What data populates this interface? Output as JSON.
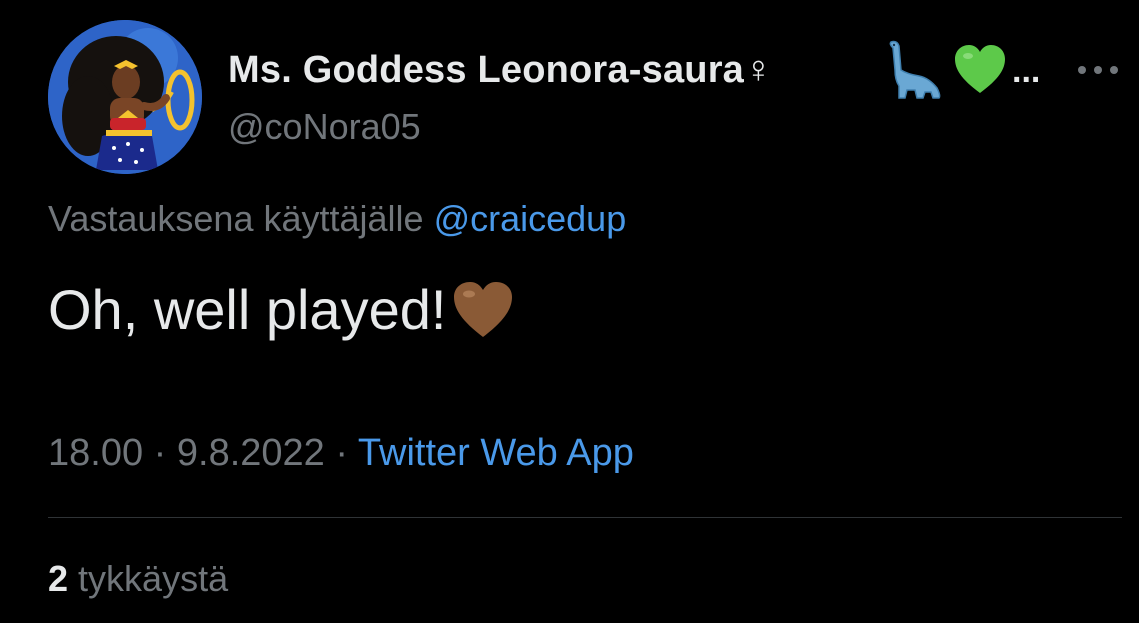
{
  "tweet": {
    "author": {
      "display_name": "Ms. Goddess Leonora-saura♀",
      "name_emojis": [
        "dinosaur-icon",
        "green-heart-icon"
      ],
      "name_ellipsis": "...",
      "handle": "@coNora05"
    },
    "reply_prefix": "Vastauksena käyttäjälle",
    "reply_to": "@craicedup",
    "text": "Oh, well played!",
    "text_emoji": "brown-heart-icon",
    "time": "18.00",
    "separator": " · ",
    "date": "9.8.2022",
    "source": "Twitter Web App",
    "likes_count": "2",
    "likes_label": "tykkäystä"
  },
  "colors": {
    "background": "#000000",
    "text_primary": "#e7e9ea",
    "text_secondary": "#71767b",
    "link": "#4a99e9",
    "divider": "#2f3336"
  }
}
